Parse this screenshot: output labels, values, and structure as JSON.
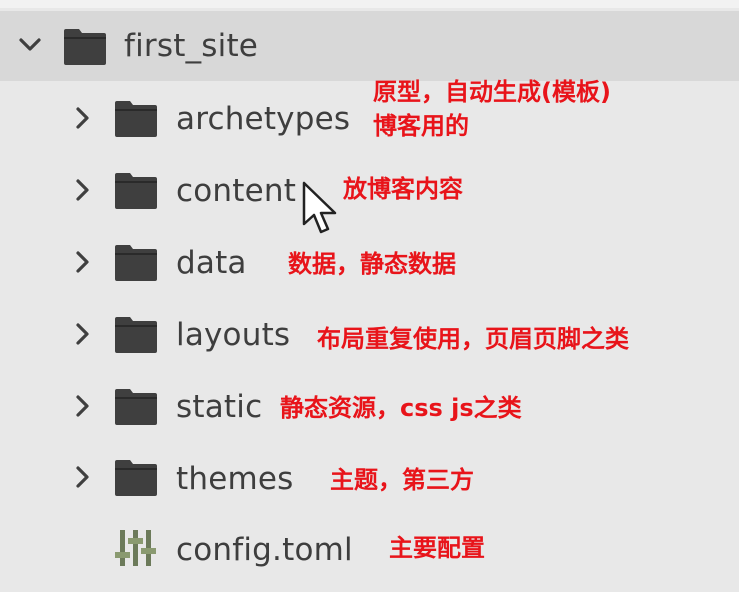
{
  "tree": {
    "root": {
      "name": "first_site",
      "expanded": true,
      "icon": "folder-icon",
      "toggle_icon": "chevron-down-icon"
    },
    "items": [
      {
        "name": "archetypes",
        "type": "folder",
        "icon": "folder-icon",
        "toggle_icon": "chevron-right-icon",
        "note": "原型，自动生成(模板)",
        "note2": "博客用的"
      },
      {
        "name": "content",
        "type": "folder",
        "icon": "folder-icon",
        "toggle_icon": "chevron-right-icon",
        "note": "放博客内容"
      },
      {
        "name": "data",
        "type": "folder",
        "icon": "folder-icon",
        "toggle_icon": "chevron-right-icon",
        "note": "数据，静态数据"
      },
      {
        "name": "layouts",
        "type": "folder",
        "icon": "folder-icon",
        "toggle_icon": "chevron-right-icon",
        "note": "布局重复使用，页眉页脚之类"
      },
      {
        "name": "static",
        "type": "folder",
        "icon": "folder-icon",
        "toggle_icon": "chevron-right-icon",
        "note": "静态资源，css js之类"
      },
      {
        "name": "themes",
        "type": "folder",
        "icon": "folder-icon",
        "toggle_icon": "chevron-right-icon",
        "note": "主题，第三方"
      },
      {
        "name": "config.toml",
        "type": "file",
        "icon": "settings-file-icon",
        "note": "主要配置"
      }
    ]
  },
  "colors": {
    "background": "#e8e8e8",
    "root_row_highlight": "#d8d8d8",
    "label_text": "#3e3e3e",
    "annotation_text": "#e8141a",
    "folder_icon": "#3f3f3f",
    "config_icon": "#6c7a5a"
  }
}
